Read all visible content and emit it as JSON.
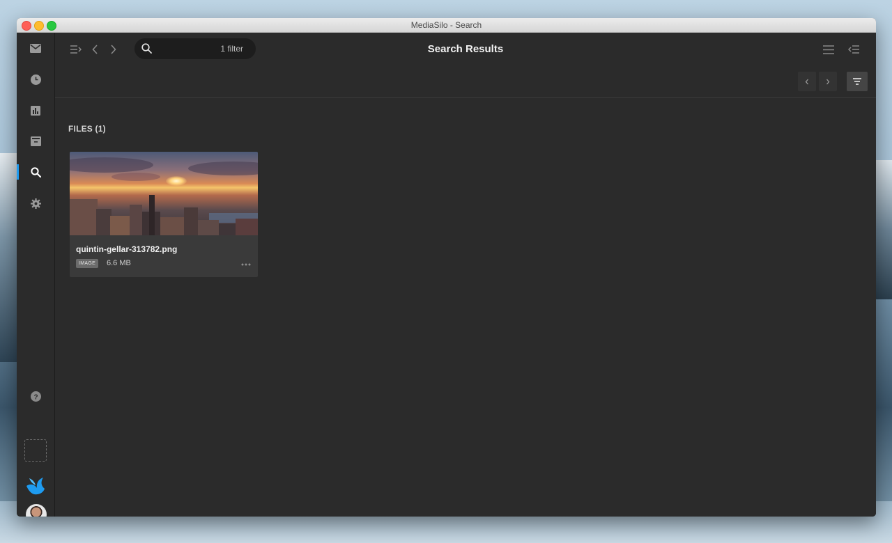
{
  "window": {
    "title": "MediaSilo - Search"
  },
  "sidebar": {
    "items": [
      {
        "name": "inbox",
        "icon": "mail-icon"
      },
      {
        "name": "recent",
        "icon": "clock-icon"
      },
      {
        "name": "analytics",
        "icon": "bar-chart-icon"
      },
      {
        "name": "archive",
        "icon": "archive-icon"
      },
      {
        "name": "search",
        "icon": "search-icon",
        "active": true
      },
      {
        "name": "settings",
        "icon": "gear-icon"
      },
      {
        "name": "help",
        "icon": "help-icon"
      }
    ],
    "accent": "#1e9bf0"
  },
  "toolbar": {
    "search": {
      "filter_label": "1 filter"
    },
    "title": "Search Results"
  },
  "results": {
    "section_label": "FILES (1)",
    "files": [
      {
        "name": "quintin-gellar-313782.png",
        "type": "IMAGE",
        "size": "6.6 MB"
      }
    ]
  }
}
